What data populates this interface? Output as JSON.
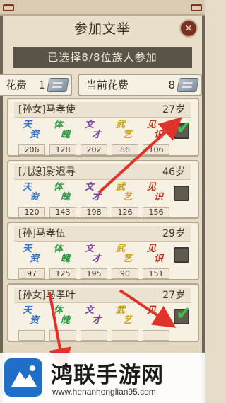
{
  "dialog": {
    "title": "参加文举",
    "selected_text": "已选择8/8位族人参加",
    "close_label": "×"
  },
  "costs": {
    "left_label": "花费",
    "left_value": "1",
    "right_label": "当前花费",
    "right_value": "8"
  },
  "stat_labels": [
    {
      "g1": "天",
      "g2": "资"
    },
    {
      "g1": "体",
      "g2": "魄"
    },
    {
      "g1": "文",
      "g2": "才"
    },
    {
      "g1": "武",
      "g2": "艺"
    },
    {
      "g1": "见",
      "g2": "识"
    }
  ],
  "members": [
    {
      "name": "[孙女]马孝使",
      "age": "27岁",
      "stats": [
        "206",
        "128",
        "202",
        "86",
        "106"
      ],
      "checked": true
    },
    {
      "name": "[儿媳]尉迟寻",
      "age": "46岁",
      "stats": [
        "120",
        "143",
        "198",
        "126",
        "156"
      ],
      "checked": false
    },
    {
      "name": "[孙]马孝伍",
      "age": "29岁",
      "stats": [
        "97",
        "125",
        "195",
        "90",
        "151"
      ],
      "checked": false
    },
    {
      "name": "[孙女]马孝叶",
      "age": "27岁",
      "stats": [
        "",
        "",
        "",
        "",
        ""
      ],
      "checked": true
    }
  ],
  "watermark": {
    "title": "鸿联手游网",
    "url": "www.henanhonglian95.com"
  },
  "colors": {
    "frame": "#6e6657",
    "header_bar": "#5a5448",
    "check_green": "#43c04a",
    "arrow_red": "#e0332a"
  }
}
